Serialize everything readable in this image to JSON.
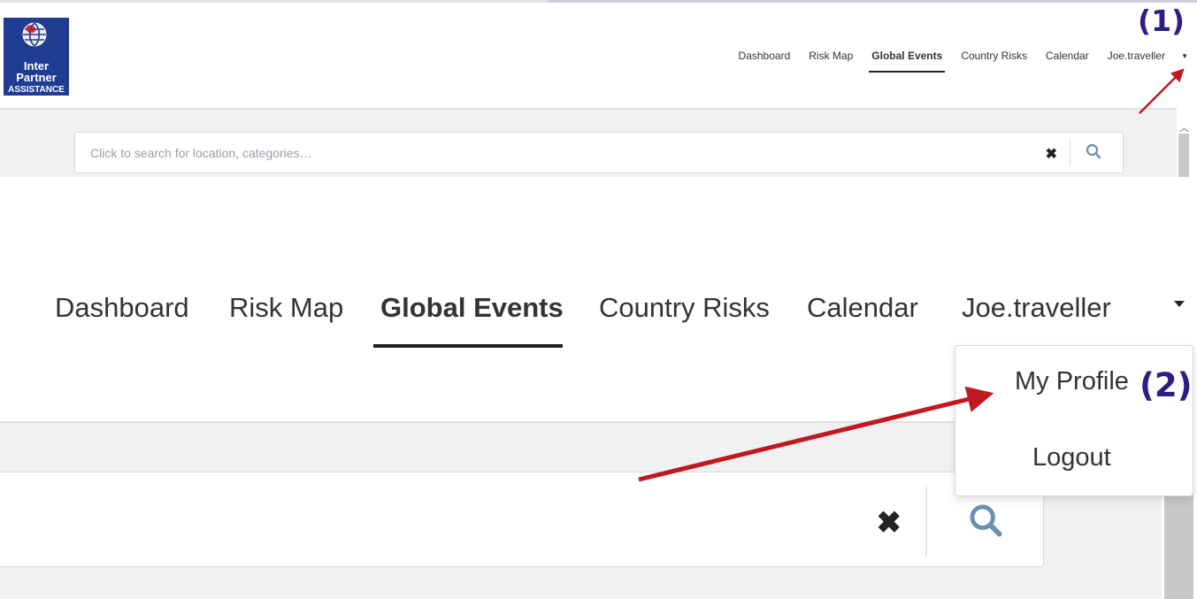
{
  "logo": {
    "line1": "Inter",
    "line2": "Partner",
    "line3": "ASSISTANCE"
  },
  "nav": {
    "items": [
      "Dashboard",
      "Risk Map",
      "Global Events",
      "Country Risks",
      "Calendar"
    ],
    "active": "Global Events",
    "user": "Joe.traveller"
  },
  "search": {
    "placeholder": "Click to search for location, categories…"
  },
  "user_menu": {
    "profile": "My Profile",
    "logout": "Logout"
  },
  "annotations": {
    "step1": "(1)",
    "step2": "(2)"
  },
  "colors": {
    "logo_bg": "#1f3c93",
    "annotation": "#2a1f82",
    "arrow": "#c0181f",
    "search_icon": "#6b8fb3"
  },
  "icons": [
    "globe-icon",
    "clear-icon",
    "search-icon",
    "caret-down-icon",
    "chevron-up-icon"
  ]
}
